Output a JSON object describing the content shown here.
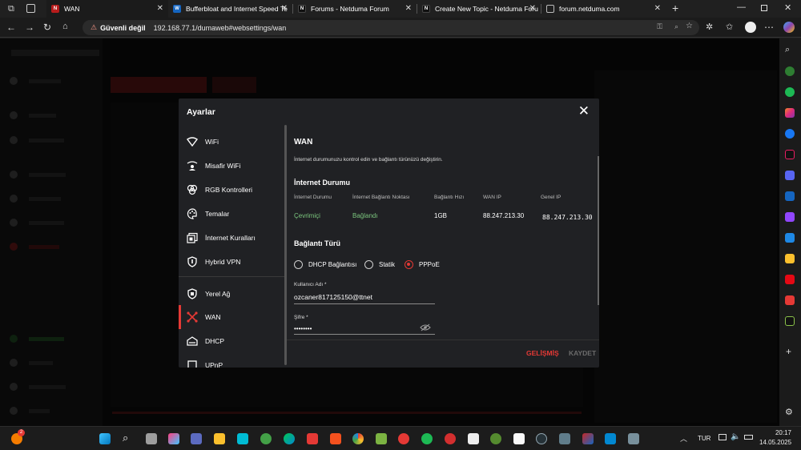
{
  "browser": {
    "tabs": [
      {
        "label": "WAN",
        "favicon": "netduma-icon",
        "active": true
      },
      {
        "label": "Bufferbloat and Internet Speed Te",
        "favicon": "waveform-icon"
      },
      {
        "label": "Forums - Netduma Forum",
        "favicon": "N"
      },
      {
        "label": "Create New Topic - Netduma Foru",
        "favicon": "N"
      },
      {
        "label": "forum.netduma.com",
        "favicon": "page-icon"
      }
    ],
    "security_label": "Güvenli değil",
    "url": "192.168.77.1/dumaweb#websettings/wan"
  },
  "modal": {
    "title": "Ayarlar",
    "menu": [
      {
        "label": "WiFi",
        "icon": "wifi-icon"
      },
      {
        "label": "Misafir WiFi",
        "icon": "guest-wifi-icon"
      },
      {
        "label": "RGB Kontrolleri",
        "icon": "rgb-icon"
      },
      {
        "label": "Temalar",
        "icon": "palette-icon"
      },
      {
        "label": "İnternet Kuralları",
        "icon": "rules-icon"
      },
      {
        "label": "Hybrid VPN",
        "icon": "shield-icon"
      },
      {
        "label": "Yerel Ağ",
        "icon": "local-network-icon"
      },
      {
        "label": "WAN",
        "icon": "wan-icon",
        "active": true
      },
      {
        "label": "DHCP",
        "icon": "dhcp-icon"
      },
      {
        "label": "UPnP",
        "icon": "upnp-icon"
      }
    ],
    "wan": {
      "title": "WAN",
      "description": "İnternet durumunuzu kontrol edin ve bağlantı türünüzü değiştirin.",
      "internet_status_heading": "İnternet Durumu",
      "columns": [
        "İnternet Durumu",
        "İnternet Bağlantı Noktası",
        "Bağlantı Hızı",
        "WAN IP",
        "Genel IP"
      ],
      "values": [
        "Çevrimiçi",
        "Bağlandı",
        "1GB",
        "88.247.213.30",
        "88.247.213.30"
      ],
      "connection_type_heading": "Bağlantı Türü",
      "options": [
        "DHCP Bağlantısı",
        "Statik",
        "PPPoE"
      ],
      "selected_option": "PPPoE",
      "username_label": "Kullanıcı Adı *",
      "username_value": "ozcaner817125150@ttnet",
      "password_label": "Şifre *",
      "password_value": "••••••••"
    },
    "buttons": {
      "advanced": "GELİŞMİŞ",
      "save": "KAYDET"
    }
  },
  "taskbar": {
    "language": "TUR",
    "time": "20:17",
    "date": "14.05.2025",
    "notification_count": "2"
  },
  "colors": {
    "accent": "#e53935",
    "online": "#7bc67e",
    "modal_bg": "#202124"
  }
}
